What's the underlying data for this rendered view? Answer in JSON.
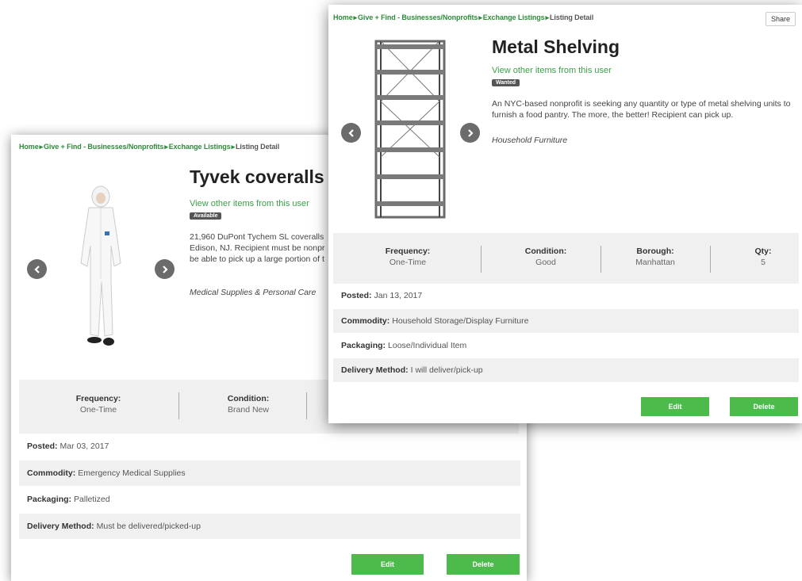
{
  "back_listing": {
    "breadcrumb": [
      "Home",
      "Give + Find - Businesses/Nonprofits",
      "Exchange Listings",
      "Listing Detail"
    ],
    "title": "Tyvek coveralls",
    "user_link": "View other items from this user",
    "status_badge": "Available",
    "description": "21,960 DuPont Tychem SL coveralls in Edison, NJ. Recipient must be nonpr be able to pick up a large portion of t",
    "description_lines": [
      "21,960 DuPont Tychem SL coveralls",
      "Edison, NJ. Recipient must be nonpr",
      "be able to pick up a large portion of t"
    ],
    "category": "Medical Supplies & Personal Care",
    "stats": [
      {
        "label": "Frequency:",
        "value": "One-Time"
      },
      {
        "label": "Condition:",
        "value": "Brand New"
      }
    ],
    "details": [
      {
        "label": "Posted:",
        "value": "Mar 03, 2017"
      },
      {
        "label": "Commodity:",
        "value": "Emergency Medical Supplies"
      },
      {
        "label": "Packaging:",
        "value": "Palletized"
      },
      {
        "label": "Delivery Method:",
        "value": "Must be delivered/picked-up"
      }
    ],
    "edit_label": "Edit",
    "delete_label": "Delete"
  },
  "front_listing": {
    "breadcrumb": [
      "Home",
      "Give + Find - Businesses/Nonprofits",
      "Exchange Listings",
      "Listing Detail"
    ],
    "share_label": "Share",
    "title": "Metal Shelving",
    "user_link": "View other items from this user",
    "status_badge": "Wanted",
    "description": "An NYC-based nonprofit is seeking any quantity or type of metal shelving units to furnish a food pantry. The more, the better! Recipient can pick up.",
    "description_lines": [
      "An NYC-based nonprofit is seeking any quantity or type of metal shelving units to",
      "furnish a food pantry. The more, the better! Recipient can pick up."
    ],
    "category": "Household Furniture",
    "stats": [
      {
        "label": "Frequency:",
        "value": "One-Time"
      },
      {
        "label": "Condition:",
        "value": "Good"
      },
      {
        "label": "Borough:",
        "value": "Manhattan"
      },
      {
        "label": "Qty:",
        "value": "5"
      }
    ],
    "details": [
      {
        "label": "Posted:",
        "value": "Jan 13, 2017"
      },
      {
        "label": "Commodity:",
        "value": "Household Storage/Display Furniture"
      },
      {
        "label": "Packaging:",
        "value": "Loose/Individual Item"
      },
      {
        "label": "Delivery Method:",
        "value": "I will deliver/pick-up"
      }
    ],
    "edit_label": "Edit",
    "delete_label": "Delete"
  },
  "colors": {
    "accent_green": "#4cbb4c",
    "link_green": "#3aa04a",
    "badge_gray": "#555555"
  },
  "icons": [
    "chevron-left-icon",
    "chevron-right-icon"
  ]
}
